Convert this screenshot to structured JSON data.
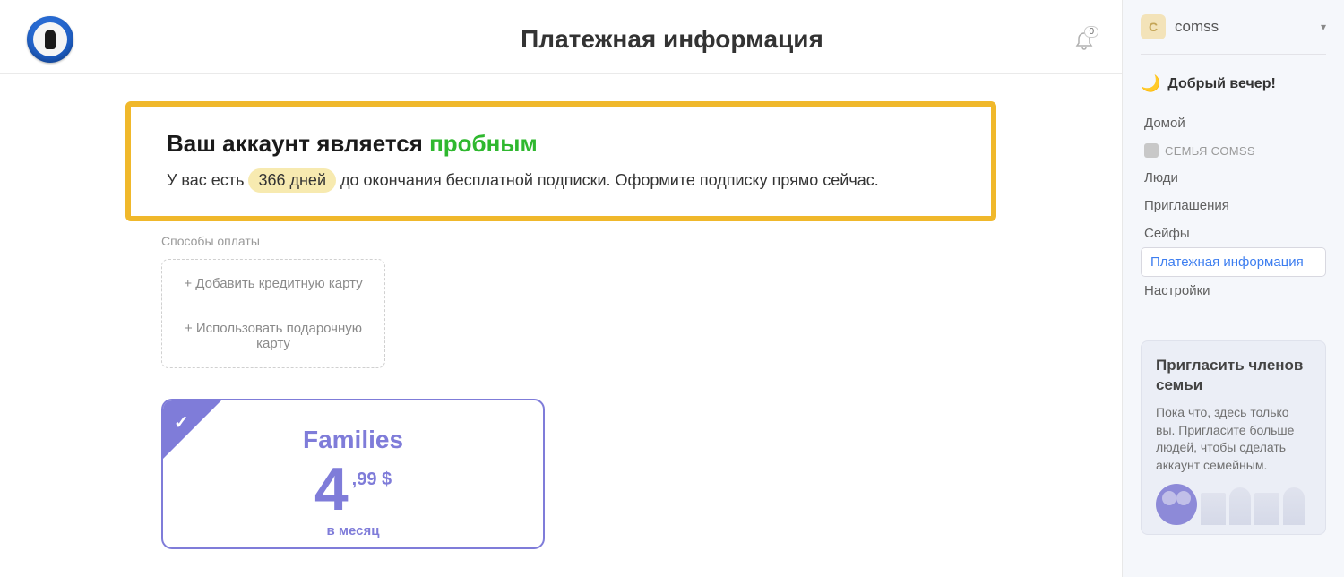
{
  "header": {
    "page_title": "Платежная информация",
    "notifications_count": "0"
  },
  "trial": {
    "title_prefix": "Ваш аккаунт является ",
    "title_word": "пробным",
    "subtitle_prefix": "У вас есть ",
    "days_badge": "366 дней",
    "subtitle_suffix": " до окончания бесплатной подписки. Оформите подписку прямо сейчас."
  },
  "payments": {
    "methods_label": "Способы оплаты",
    "add_card": "+ Добавить кредитную карту",
    "use_gift": "+ Использовать подарочную карту"
  },
  "plan": {
    "name": "Families",
    "price_major": "4",
    "price_minor": ",99 $",
    "period": "в месяц"
  },
  "sidebar": {
    "avatar_letter": "C",
    "username": "comss",
    "greeting": "Добрый вечер!",
    "family_label": "СЕМЬЯ COMSS",
    "nav": {
      "home": "Домой",
      "people": "Люди",
      "invites": "Приглашения",
      "vaults": "Сейфы",
      "billing": "Платежная информация",
      "settings": "Настройки"
    },
    "invite_card": {
      "title": "Пригласить членов семьи",
      "text": "Пока что, здесь только вы. Пригласите больше людей, чтобы сделать аккаунт семейным."
    }
  }
}
